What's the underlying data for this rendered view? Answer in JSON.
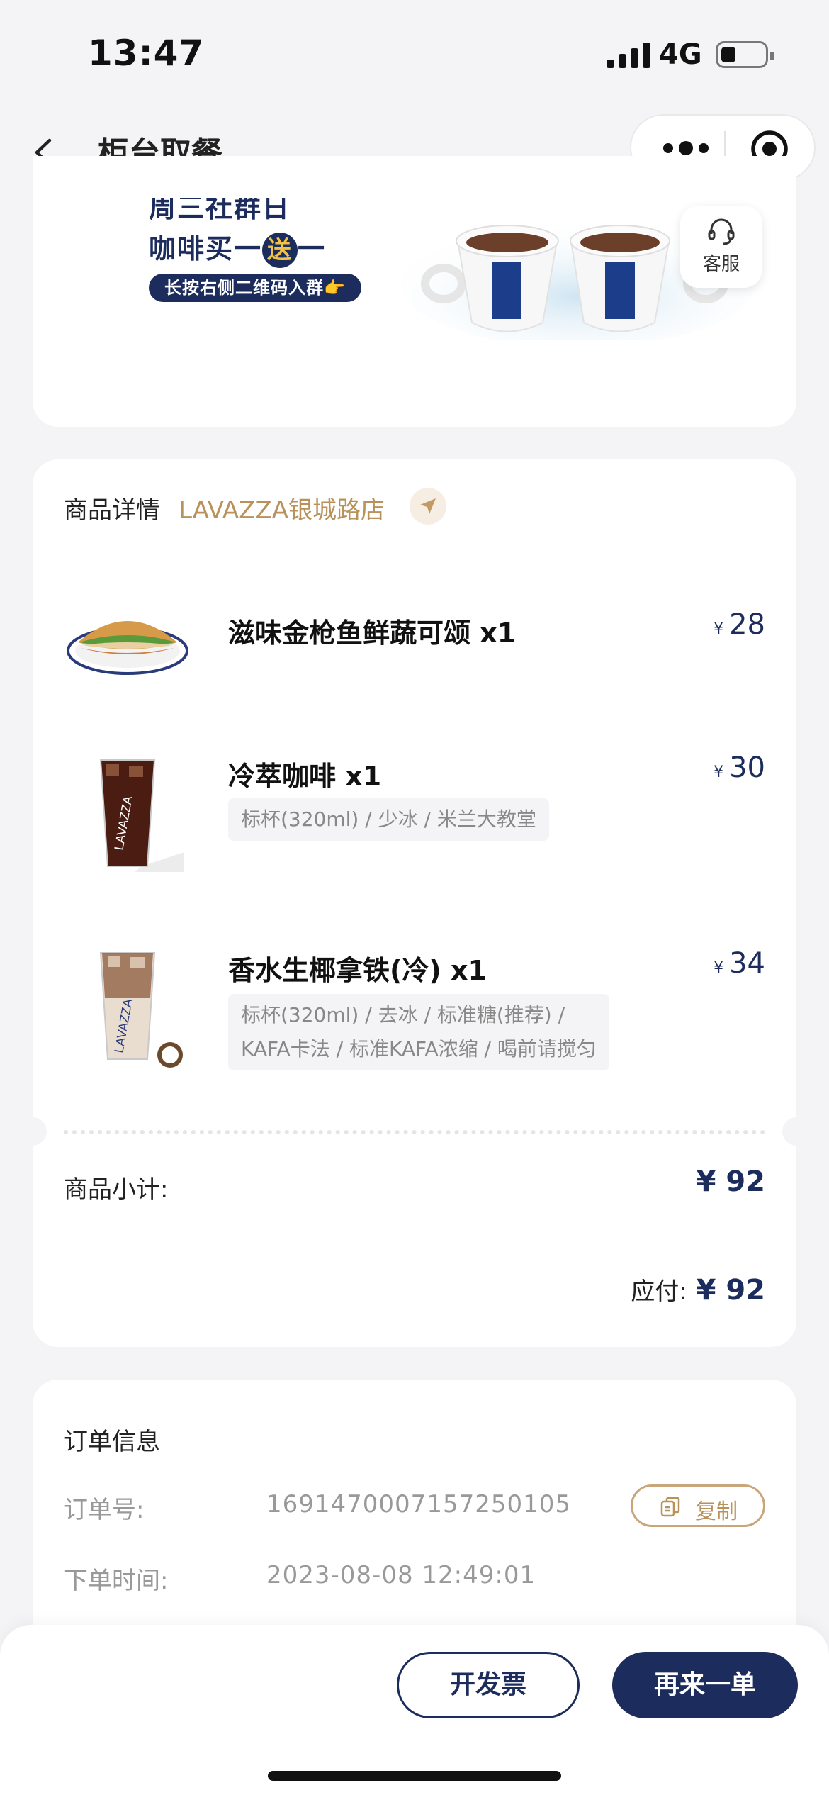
{
  "status_bar": {
    "time": "13:47",
    "network": "4G"
  },
  "nav": {
    "title": "柜台取餐",
    "icons": [
      "back-icon",
      "more-icon",
      "target-icon"
    ]
  },
  "banner": {
    "line1": "周三社群日",
    "line2_pre": "咖啡买一",
    "line2_circle": "送",
    "line2_post": "一",
    "pill": "长按右侧二维码入群👉",
    "service_label": "客服"
  },
  "detail": {
    "heading": "商品详情",
    "store": "LAVAZZA银城路店",
    "items": [
      {
        "name": "滋味金枪鱼鲜蔬可颂 x1",
        "currency": "¥",
        "price": "28",
        "spec": ""
      },
      {
        "name": "冷萃咖啡 x1",
        "currency": "¥",
        "price": "30",
        "spec": "标杯(320ml) / 少冰 / 米兰大教堂"
      },
      {
        "name": "香水生椰拿铁(冷) x1",
        "currency": "¥",
        "price": "34",
        "spec_line1": "标杯(320ml) / 去冰 / 标准糖(推荐) /",
        "spec_line2": "KAFA卡法 / 标准KAFA浓缩 / 喝前请搅匀"
      }
    ],
    "subtotal_label": "商品小计:",
    "subtotal_value": "¥ 92",
    "payable_label": "应付:",
    "payable_value": "¥ 92"
  },
  "order_info": {
    "title": "订单信息",
    "order_no_label": "订单号:",
    "order_no": "1691470007157250105",
    "copy_label": "复制",
    "time_label": "下单时间:",
    "time_value": "2023-08-08 12:49:01"
  },
  "actions": {
    "invoice": "开发票",
    "reorder": "再来一单"
  },
  "colors": {
    "brand_navy": "#1c2c5c",
    "accent_gold": "#b9925b",
    "background": "#f4f4f6"
  }
}
